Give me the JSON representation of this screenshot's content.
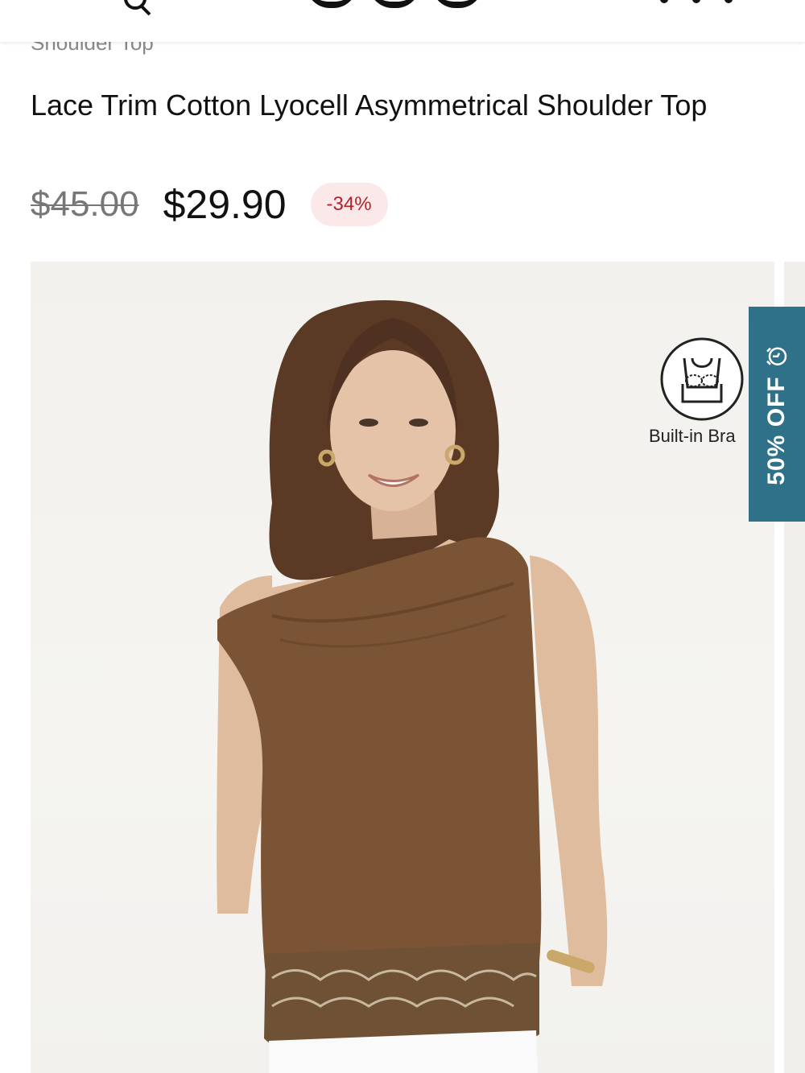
{
  "header": {
    "icons": [
      "search-icon",
      "more-icon"
    ]
  },
  "breadcrumb": {
    "fragment": "Shoulder Top"
  },
  "product": {
    "title": "Lace Trim Cotton Lyocell Asymmetrical Shoulder Top",
    "price_original": "$45.00",
    "price_sale": "$29.90",
    "discount": "-34%"
  },
  "gallery": {
    "feature_badge": {
      "icon": "bra-icon",
      "label": "Built-in Bra"
    },
    "promo_tab": {
      "label": "50% OFF",
      "icon": "alarm-clock-icon",
      "color": "#2e7188"
    }
  },
  "colors": {
    "accent_discount": "#b3222b",
    "badge_bg": "#fbe9e9",
    "promo": "#2e7188"
  }
}
